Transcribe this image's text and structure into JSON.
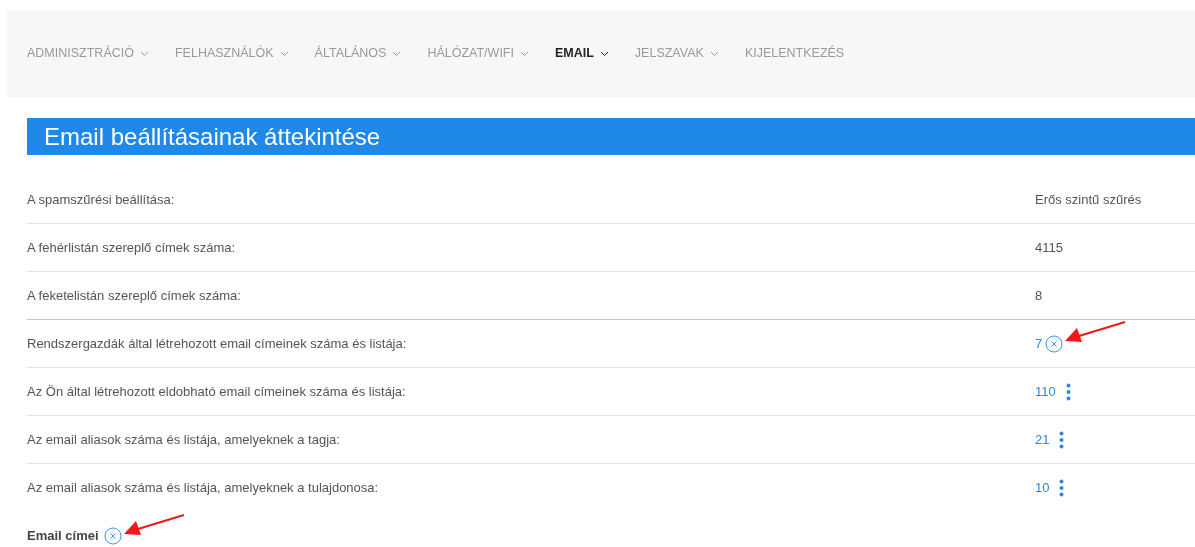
{
  "nav": [
    {
      "label": "ADMINISZTRÁCIÓ",
      "selected": false
    },
    {
      "label": "FELHASZNÁLÓK",
      "selected": false
    },
    {
      "label": "ÁLTALÁNOS",
      "selected": false
    },
    {
      "label": "HÁLÓZAT/WIFI",
      "selected": false
    },
    {
      "label": "EMAIL",
      "selected": true
    },
    {
      "label": "JELSZAVAK",
      "selected": false
    },
    {
      "label": "KIJELENTKEZÉS",
      "selected": false,
      "kind": "plain"
    }
  ],
  "heading": "Email beállításainak áttekintése",
  "rows": [
    {
      "label": "A spamszűrési beállítása:",
      "value": "Erős szintű szűrés",
      "kind": "text"
    },
    {
      "label": "A fehérlistán szereplő címek száma:",
      "value": "4115",
      "kind": "text"
    },
    {
      "label": "A feketelistán szereplő címek száma:",
      "value": "8",
      "kind": "text"
    },
    {
      "label": "Rendszergazdák által létrehozott email címeinek száma és listája:",
      "value": "7",
      "kind": "close",
      "annotated": true
    },
    {
      "label": "Az Ön által létrehozott eldobható email címeinek száma és listája:",
      "value": "110",
      "kind": "menu"
    },
    {
      "label": "Az email aliasok száma és listája, amelyeknek a tagja:",
      "value": "21",
      "kind": "menu"
    },
    {
      "label": "Az email aliasok száma és listája, amelyeknek a tulajdonosa:",
      "value": "10",
      "kind": "menu"
    }
  ],
  "section": {
    "title": "Email címei",
    "annotated": true
  }
}
